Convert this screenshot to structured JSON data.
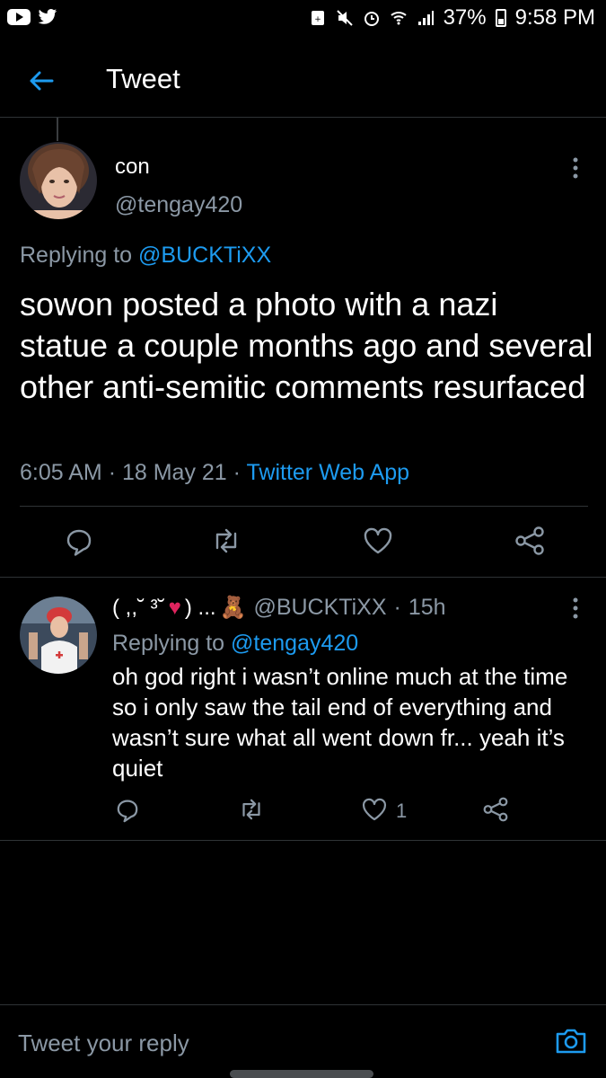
{
  "status_bar": {
    "battery": "37%",
    "time": "9:58 PM",
    "icons": [
      "youtube-icon",
      "twitter-icon",
      "sim-icon",
      "mute-icon",
      "alarm-icon",
      "wifi-icon",
      "signal-icon",
      "battery-icon"
    ]
  },
  "header": {
    "title": "Tweet",
    "back_icon": "arrow-left-icon"
  },
  "tweet": {
    "display_name": "con",
    "handle": "@tengay420",
    "replying_prefix": "Replying to ",
    "replying_to": "@BUCKTiXX",
    "text": "sowon posted a photo with a nazi statue a couple months ago and several other anti-semitic comments resurfaced",
    "time": "6:05 AM",
    "date": "18 May 21",
    "source": "Twitter Web App",
    "sep": "·",
    "actions": [
      "reply-icon",
      "retweet-icon",
      "like-icon",
      "share-icon"
    ]
  },
  "reply": {
    "display_name_a": "( ,,˘ ³˘",
    "heart": "♥",
    "display_name_b": ") ...",
    "bear": "🧸",
    "handle": "@BUCKTiXX",
    "sep": "·",
    "age": "15h",
    "replying_prefix": "Replying to ",
    "replying_to": "@tengay420",
    "text": "oh god right i wasn’t online much at the time so i only saw the tail end of everything and wasn’t sure what all went down fr... yeah it’s quiet",
    "like_count": "1"
  },
  "composer": {
    "placeholder": "Tweet your reply",
    "camera_icon": "camera-icon"
  },
  "colors": {
    "background": "#000000",
    "accent": "#1d9bf0",
    "muted": "#8b98a5",
    "divider": "#2f3336"
  }
}
